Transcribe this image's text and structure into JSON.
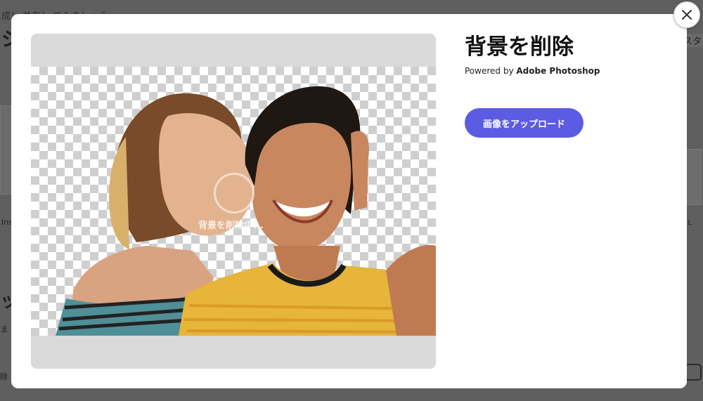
{
  "background": {
    "top_text": "成し 共有し てみましょう",
    "heading": "ジ",
    "right_text": "スタ",
    "left_label": "Ins",
    "left_heading": "ッシ",
    "left_small": "ま",
    "left_small2": "除",
    "right_label": "L"
  },
  "modal": {
    "title": "背景を削除",
    "powered_prefix": "Powered by ",
    "powered_brand": "Adobe Photoshop",
    "upload_label": "画像をアップロード",
    "processing_label": "背景を削除中..."
  },
  "close_icon": "close-icon",
  "colors": {
    "accent": "#5b5be3",
    "overlay": "#5a5a5a"
  }
}
